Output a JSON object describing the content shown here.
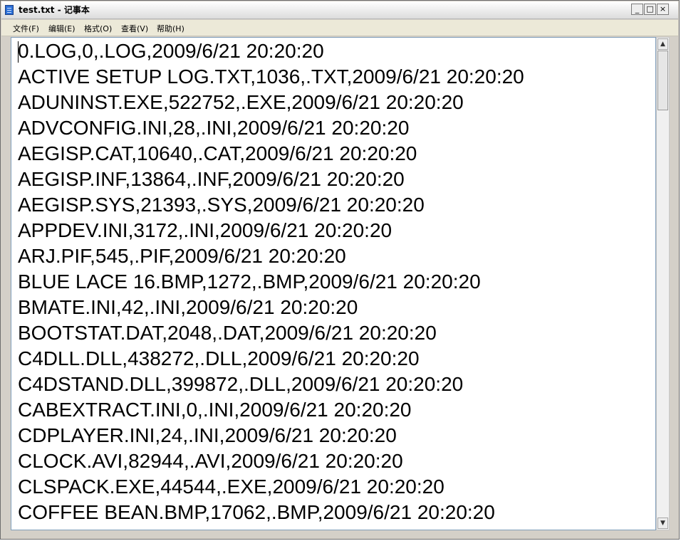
{
  "window": {
    "title": "test.txt - 记事本",
    "minimize_glyph": "_",
    "maximize_glyph": "□",
    "close_glyph": "×"
  },
  "menu": {
    "items": [
      "文件(F)",
      "编辑(E)",
      "格式(O)",
      "查看(V)",
      "帮助(H)"
    ]
  },
  "editor": {
    "lines": [
      "0.LOG,0,.LOG,2009/6/21 20:20:20",
      "ACTIVE SETUP LOG.TXT,1036,.TXT,2009/6/21 20:20:20",
      "ADUNINST.EXE,522752,.EXE,2009/6/21 20:20:20",
      "ADVCONFIG.INI,28,.INI,2009/6/21 20:20:20",
      "AEGISP.CAT,10640,.CAT,2009/6/21 20:20:20",
      "AEGISP.INF,13864,.INF,2009/6/21 20:20:20",
      "AEGISP.SYS,21393,.SYS,2009/6/21 20:20:20",
      "APPDEV.INI,3172,.INI,2009/6/21 20:20:20",
      "ARJ.PIF,545,.PIF,2009/6/21 20:20:20",
      "BLUE LACE 16.BMP,1272,.BMP,2009/6/21 20:20:20",
      "BMATE.INI,42,.INI,2009/6/21 20:20:20",
      "BOOTSTAT.DAT,2048,.DAT,2009/6/21 20:20:20",
      "C4DLL.DLL,438272,.DLL,2009/6/21 20:20:20",
      "C4DSTAND.DLL,399872,.DLL,2009/6/21 20:20:20",
      "CABEXTRACT.INI,0,.INI,2009/6/21 20:20:20",
      "CDPLAYER.INI,24,.INI,2009/6/21 20:20:20",
      "CLOCK.AVI,82944,.AVI,2009/6/21 20:20:20",
      "CLSPACK.EXE,44544,.EXE,2009/6/21 20:20:20",
      "COFFEE BEAN.BMP,17062,.BMP,2009/6/21 20:20:20"
    ]
  },
  "scrollbar": {
    "up_glyph": "▲",
    "down_glyph": "▼",
    "position_fraction": 0.0
  },
  "colors": {
    "text": "#000000",
    "background": "#ffffff",
    "icon": "#2b6fd6"
  }
}
